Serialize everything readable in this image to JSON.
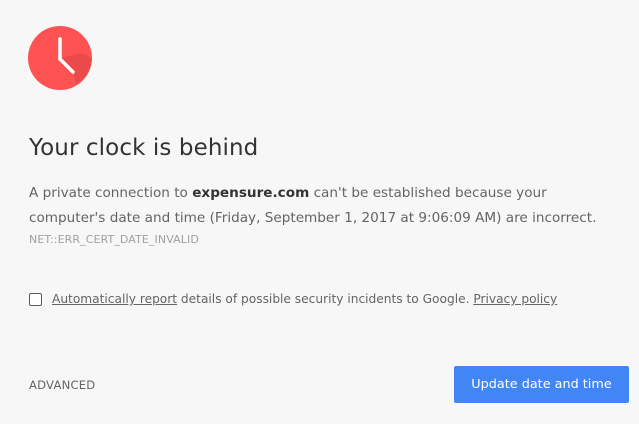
{
  "icon": {
    "name": "clock-icon",
    "bg_color": "#ff5252"
  },
  "title": "Your clock is behind",
  "message": {
    "prefix": "A private connection to ",
    "host": "expensure.com",
    "suffix": " can't be established because your computer's date and time (Friday, September 1, 2017 at 9:06:09 AM) are incorrect."
  },
  "error_code": "NET::ERR_CERT_DATE_INVALID",
  "report": {
    "checked": false,
    "link_text": "Automatically report",
    "middle_text": " details of possible security incidents to Google. ",
    "privacy_link": "Privacy policy"
  },
  "advanced_label": "ADVANCED",
  "primary_button_label": "Update date and time",
  "colors": {
    "accent": "#4285f4",
    "icon": "#ff5252"
  }
}
